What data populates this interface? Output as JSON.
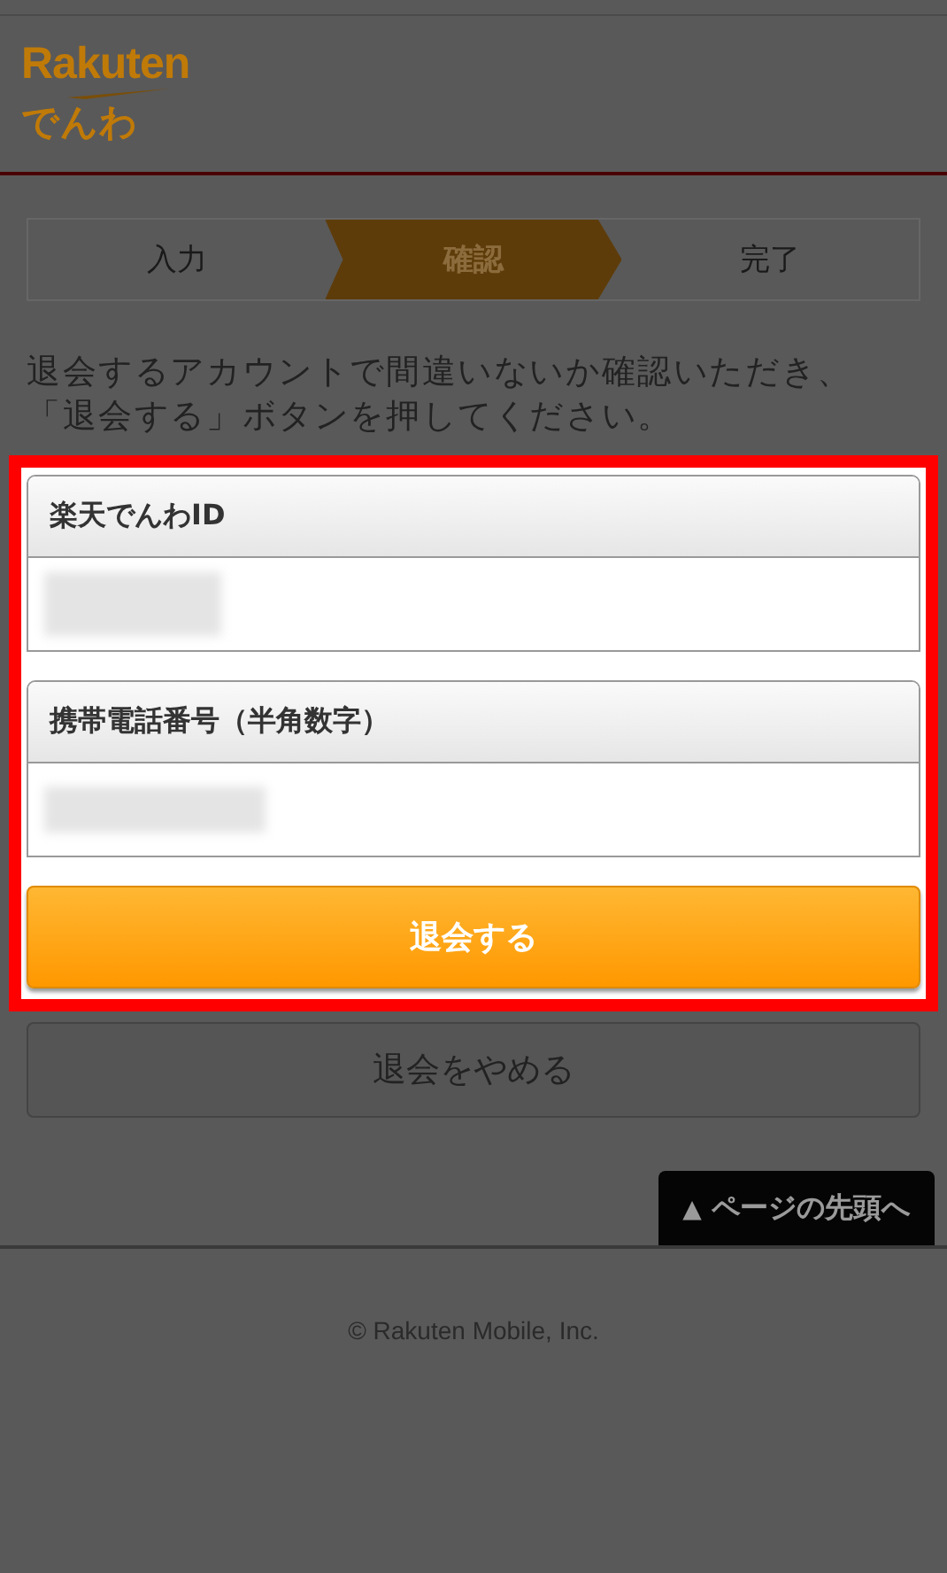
{
  "logo": {
    "brand": "Rakuten",
    "service": "でんわ"
  },
  "steps": [
    {
      "label": "入力",
      "selected": false
    },
    {
      "label": "確認",
      "selected": true
    },
    {
      "label": "完了",
      "selected": false
    }
  ],
  "instruction": "退会するアカウントで間違いないか確認いただき、「退会する」ボタンを押してください。",
  "highlighted": true,
  "fields": [
    {
      "label": "楽天でんわID",
      "redacted": true
    },
    {
      "label": "携帯電話番号（半角数字）",
      "redacted": true
    }
  ],
  "submit_button": "退会する",
  "cancel_button": "退会をやめる",
  "back_to_top": {
    "icon": "▲",
    "label": "ページの先頭へ"
  },
  "footer": "© Rakuten Mobile, Inc."
}
